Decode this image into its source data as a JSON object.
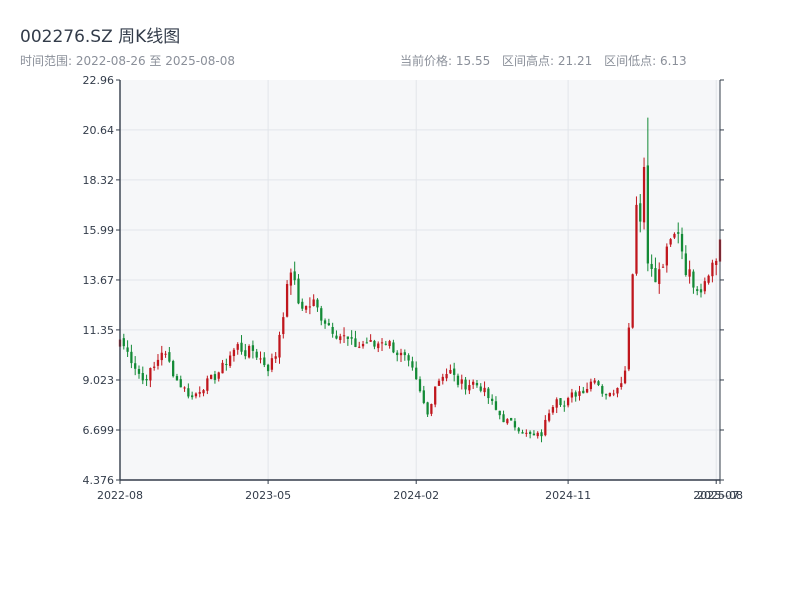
{
  "header": {
    "title": "002276.SZ 周K线图",
    "date_range": "时间范围: 2022-08-26 至 2025-08-08",
    "current_price": "当前价格: 15.55",
    "range_high": "区间高点: 21.21",
    "range_low": "区间低点: 6.13"
  },
  "colors": {
    "up": "#c0161d",
    "down": "#138a36",
    "plot_background": "#f6f7f9",
    "grid": "#e2e5ea",
    "axis": "#333c4a"
  },
  "chart_data": {
    "type": "candlestick",
    "title": "002276.SZ 周K线图",
    "ylim": [
      4.376,
      22.96
    ],
    "yticks": [
      "4.376",
      "6.699",
      "9.023",
      "11.35",
      "13.67",
      "15.99",
      "18.32",
      "20.64",
      "22.96"
    ],
    "xticks": [
      {
        "label": "2022-08",
        "index": 0
      },
      {
        "label": "2023-05",
        "index": 39
      },
      {
        "label": "2024-02",
        "index": 78
      },
      {
        "label": "2024-11",
        "index": 118
      },
      {
        "label": "2025-07",
        "index": 157
      },
      {
        "label": "2025-08",
        "index": 158
      }
    ],
    "grid": true,
    "weeks": 159,
    "close_path": [
      [
        0,
        10.9
      ],
      [
        3,
        10.0
      ],
      [
        6,
        9.0
      ],
      [
        9,
        9.6
      ],
      [
        11,
        10.4
      ],
      [
        13,
        9.8
      ],
      [
        15,
        9.0
      ],
      [
        17,
        8.6
      ],
      [
        19,
        8.2
      ],
      [
        21,
        8.6
      ],
      [
        23,
        8.9
      ],
      [
        25,
        9.2
      ],
      [
        27,
        9.6
      ],
      [
        29,
        10.2
      ],
      [
        31,
        10.6
      ],
      [
        33,
        10.3
      ],
      [
        35,
        10.4
      ],
      [
        37,
        10.0
      ],
      [
        39,
        9.6
      ],
      [
        41,
        10.2
      ],
      [
        43,
        12.2
      ],
      [
        45,
        14.2
      ],
      [
        47,
        12.6
      ],
      [
        49,
        12.4
      ],
      [
        51,
        12.6
      ],
      [
        53,
        12.0
      ],
      [
        55,
        11.6
      ],
      [
        57,
        11.2
      ],
      [
        59,
        11.0
      ],
      [
        61,
        10.7
      ],
      [
        63,
        10.6
      ],
      [
        65,
        10.8
      ],
      [
        67,
        10.6
      ],
      [
        69,
        10.9
      ],
      [
        71,
        10.7
      ],
      [
        73,
        10.3
      ],
      [
        75,
        10.0
      ],
      [
        77,
        9.4
      ],
      [
        79,
        8.4
      ],
      [
        81,
        7.4
      ],
      [
        83,
        8.8
      ],
      [
        85,
        9.3
      ],
      [
        87,
        9.4
      ],
      [
        89,
        8.9
      ],
      [
        91,
        8.8
      ],
      [
        93,
        8.9
      ],
      [
        95,
        8.7
      ],
      [
        97,
        8.2
      ],
      [
        99,
        7.6
      ],
      [
        101,
        7.2
      ],
      [
        103,
        7.0
      ],
      [
        105,
        6.8
      ],
      [
        107,
        6.5
      ],
      [
        109,
        6.4
      ],
      [
        111,
        6.5
      ],
      [
        113,
        7.6
      ],
      [
        115,
        8.3
      ],
      [
        117,
        7.8
      ],
      [
        119,
        8.3
      ],
      [
        121,
        8.5
      ],
      [
        123,
        8.7
      ],
      [
        125,
        9.2
      ],
      [
        127,
        8.5
      ],
      [
        129,
        8.3
      ],
      [
        131,
        8.8
      ],
      [
        133,
        9.4
      ],
      [
        135,
        14.0
      ],
      [
        136,
        17.5
      ],
      [
        137,
        16.4
      ],
      [
        138,
        19.0
      ],
      [
        139,
        14.8
      ],
      [
        140,
        14.0
      ],
      [
        141,
        13.6
      ],
      [
        143,
        14.4
      ],
      [
        145,
        15.4
      ],
      [
        147,
        16.0
      ],
      [
        149,
        14.2
      ],
      [
        151,
        13.6
      ],
      [
        153,
        13.3
      ],
      [
        155,
        14.2
      ],
      [
        157,
        14.6
      ],
      [
        158,
        15.55
      ]
    ],
    "last_close": 15.55,
    "high": 21.21,
    "low": 6.13
  }
}
